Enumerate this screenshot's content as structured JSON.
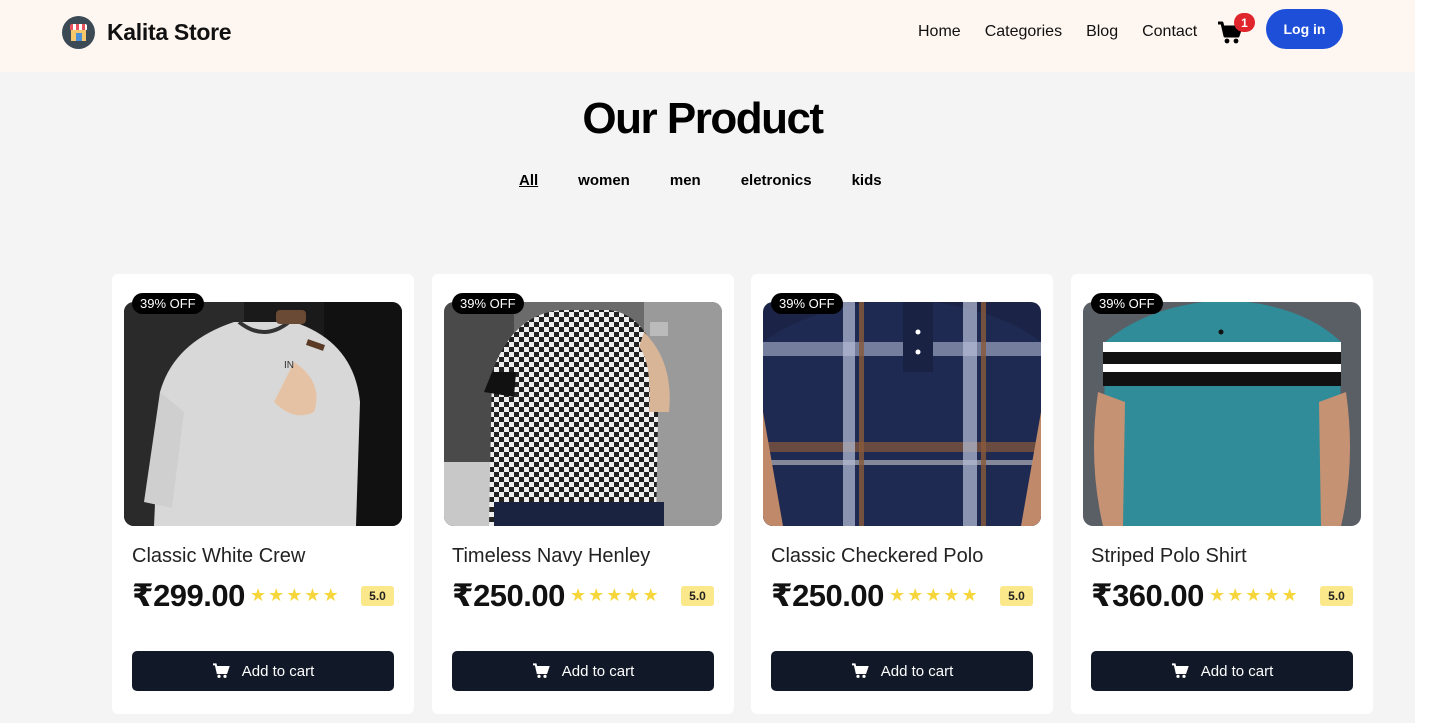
{
  "header": {
    "brand": "Kalita Store",
    "nav": [
      "Home",
      "Categories",
      "Blog",
      "Contact"
    ],
    "cart_count": "1",
    "login_label": "Log in"
  },
  "main": {
    "title": "Our Product",
    "filters": [
      "All",
      "women",
      "men",
      "eletronics",
      "kids"
    ],
    "active_filter": "All"
  },
  "products": [
    {
      "name": "Classic White Crew",
      "price": "₹299.00",
      "discount": "39% OFF",
      "rating": "5.0",
      "stars": 5,
      "cta": "Add to cart"
    },
    {
      "name": "Timeless Navy Henley",
      "price": "₹250.00",
      "discount": "39% OFF",
      "rating": "5.0",
      "stars": 5,
      "cta": "Add to cart"
    },
    {
      "name": "Classic Checkered Polo",
      "price": "₹250.00",
      "discount": "39% OFF",
      "rating": "5.0",
      "stars": 5,
      "cta": "Add to cart"
    },
    {
      "name": "Striped Polo Shirt",
      "price": "₹360.00",
      "discount": "39% OFF",
      "rating": "5.0",
      "stars": 5,
      "cta": "Add to cart"
    }
  ],
  "colors": {
    "navbar_bg": "#fef6f0",
    "page_bg": "#f4f4f4",
    "login_blue": "#1e4fd8",
    "cart_badge_red": "#e0252c",
    "button_dark": "#111827",
    "star_yellow": "#f5d63d",
    "rating_bg": "#fbe88a"
  }
}
